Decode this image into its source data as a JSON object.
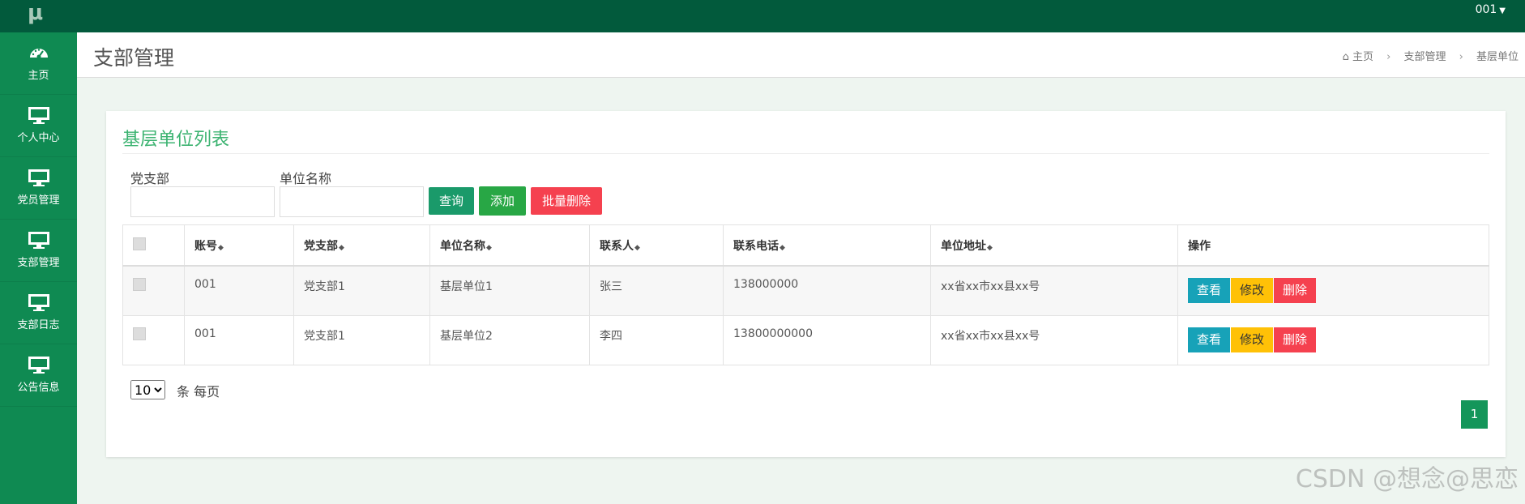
{
  "app": {
    "logo": "μ",
    "user": "001"
  },
  "sidebar": {
    "items": [
      {
        "label": "主页",
        "icon": "dashboard-icon"
      },
      {
        "label": "个人中心",
        "icon": "monitor-icon"
      },
      {
        "label": "党员管理",
        "icon": "monitor-icon"
      },
      {
        "label": "支部管理",
        "icon": "monitor-icon"
      },
      {
        "label": "支部日志",
        "icon": "monitor-icon"
      },
      {
        "label": "公告信息",
        "icon": "monitor-icon"
      }
    ]
  },
  "header": {
    "title": "支部管理",
    "breadcrumb": [
      "主页",
      "支部管理",
      "基层单位"
    ]
  },
  "panel": {
    "title": "基层单位列表",
    "filters": {
      "branch_label": "党支部",
      "branch_value": "",
      "unit_label": "单位名称",
      "unit_value": ""
    },
    "buttons": {
      "search": "查询",
      "add": "添加",
      "batch_delete": "批量删除"
    },
    "table": {
      "headers": [
        "账号",
        "党支部",
        "单位名称",
        "联系人",
        "联系电话",
        "单位地址",
        "操作"
      ],
      "rows": [
        {
          "account": "001",
          "branch": "党支部1",
          "unit": "基层单位1",
          "contact": "张三",
          "phone": "138000000",
          "address": "xx省xx市xx县xx号"
        },
        {
          "account": "001",
          "branch": "党支部1",
          "unit": "基层单位2",
          "contact": "李四",
          "phone": "13800000000",
          "address": "xx省xx市xx县xx号"
        }
      ],
      "actions": {
        "view": "查看",
        "edit": "修改",
        "delete": "删除"
      }
    },
    "pager": {
      "page_size": "10",
      "page_size_suffix": "条 每页",
      "current_page": "1"
    }
  },
  "watermark": "CSDN @想念@思恋",
  "colors": {
    "topbar": "#025a3c",
    "sidebar": "#0f8a52",
    "title_green": "#3cb371",
    "search": "#1a9a6a",
    "add": "#28a745",
    "batch_delete": "#f5414f",
    "view": "#17a2b8",
    "edit": "#ffc107",
    "delete": "#f5414f"
  }
}
